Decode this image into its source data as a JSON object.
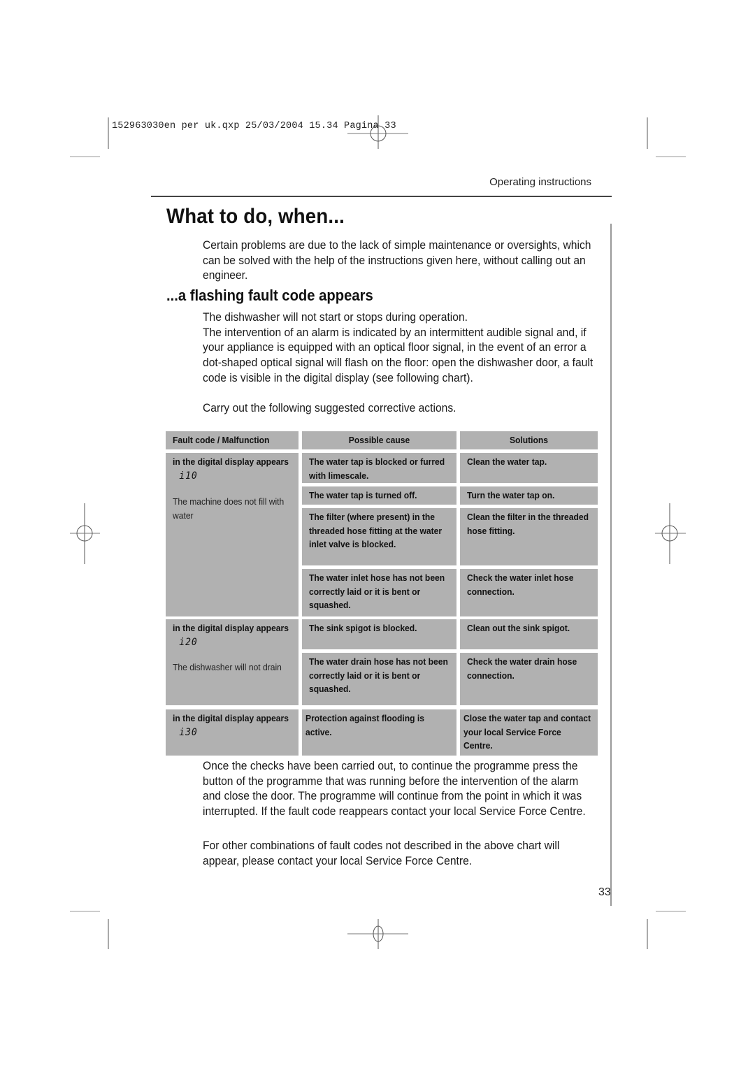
{
  "slug": "152963030en per uk.qxp  25/03/2004  15.34  Pagina 33",
  "section_header": "Operating instructions",
  "title": "What to do, when...",
  "intro": "Certain problems are due to the lack of simple maintenance or oversights, which can be solved with the help of the instructions given here, without calling out an engineer.",
  "subtitle": "...a flashing fault code appears",
  "paragraphs": [
    "The dishwasher will not start or stops during operation.",
    "The intervention of an alarm is indicated by an intermittent audible signal and, if your appliance is equipped with an optical floor signal, in the event of an error a dot-shaped optical signal will flash on the floor: open the dishwasher door, a fault code  is visible in the digital display (see following chart).",
    "Carry out the following suggested corrective actions."
  ],
  "table": {
    "headers": [
      "Fault code / Malfunction",
      "Possible cause",
      "Solutions"
    ],
    "groups": [
      {
        "fault_label": "in the digital display appears",
        "code": "i10",
        "malfunction": "The machine does not fill with water",
        "rows": [
          {
            "cause": "The water tap is blocked or furred with limescale.",
            "solution": "Clean the water tap."
          },
          {
            "cause": "The water tap is turned off.",
            "solution": "Turn the water tap on."
          },
          {
            "cause": "The filter (where present) in the threaded hose fitting at the water inlet valve is blocked.",
            "solution": "Clean the filter in the threaded hose fitting."
          },
          {
            "cause": "The water inlet hose has not been correctly laid or it is bent or squashed.",
            "solution": "Check the water inlet hose connection."
          }
        ]
      },
      {
        "fault_label": "in the digital display appears",
        "code": "i20",
        "malfunction": "The dishwasher will not drain",
        "rows": [
          {
            "cause": "The sink spigot is blocked.",
            "solution": "Clean out the sink spigot."
          },
          {
            "cause": "The water drain hose has not been correctly laid or it is bent or squashed.",
            "solution": "Check the water drain hose connection."
          }
        ]
      },
      {
        "fault_label": "in the digital display appears",
        "code": "i30",
        "malfunction": "",
        "rows": [
          {
            "cause": "Protection against flooding is active.",
            "solution": "Close the water tap and contact your local Service Force Centre."
          }
        ]
      }
    ]
  },
  "after_paragraphs": [
    "Once the checks have been carried out, to continue the programme press the button of the programme that was running before the intervention of the alarm and close the door. The programme will continue from the point in which it was interrupted. If the fault code reappears contact your local Service Force Centre.",
    "For other combinations of fault codes not described in the above chart will appear, please contact your local Service Force Centre."
  ],
  "page_number": "33",
  "colors": {
    "table_cell": "#b1b1b1",
    "text": "#111111"
  }
}
